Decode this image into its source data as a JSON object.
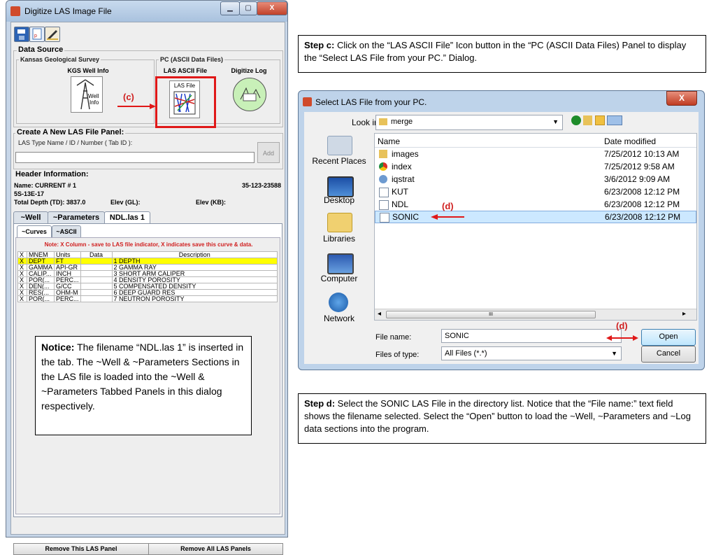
{
  "left_window": {
    "title": "Digitize LAS Image File",
    "window_buttons": [
      "▁",
      "▢",
      "X"
    ],
    "data_source": {
      "label": "Data Source",
      "kgs_group": "Kansas Geological Survey",
      "kgs_title": "KGS Well Info",
      "kgs_icon_text": "Well\nInfo",
      "pc_group": "PC (ASCII Data Files)",
      "las_title": "LAS ASCII File",
      "las_icon_text": "LAS File",
      "digitize_title": "Digitize Log",
      "callout": "(c)"
    },
    "create_panel": {
      "label": "Create A New LAS File Panel:",
      "sublabel": "LAS Type Name / ID / Number ( Tab ID ):",
      "input_value": "",
      "add_label": "Add"
    },
    "header_info": {
      "label": "Header Information:",
      "name": "Name: CURRENT # 1",
      "api": "35-123-23588",
      "location": "5S-13E-17",
      "total_depth": "Total Depth (TD): 3837.0",
      "elev_gl": "Elev (GL):",
      "elev_kb": "Elev (KB):"
    },
    "tabs": [
      "~Well",
      "~Parameters",
      "NDL.las 1"
    ],
    "subtabs": [
      "~Curves",
      "~ASCII"
    ],
    "note_text": "Note: X Column - save to LAS file indicator, X indicates save this curve & data.",
    "table": {
      "headers": [
        "X",
        "MNEM",
        "Units",
        "Data",
        "Description"
      ],
      "rows": [
        [
          "X",
          "DEPT",
          "FT",
          "",
          "1 DEPTH"
        ],
        [
          "X",
          "GAMMA",
          "API-GR",
          "",
          "2 GAMMA RAY"
        ],
        [
          "X",
          "CALIP...",
          "INCH",
          "",
          "3 SHORT ARM CALIPER"
        ],
        [
          "X",
          "POR(...",
          "PERC...",
          "",
          "4 DENSITY POROSITY"
        ],
        [
          "X",
          "DEN(...",
          "G/CC",
          "",
          "5 COMPENSATED DENSITY"
        ],
        [
          "X",
          "RES(...",
          "OHM-M",
          "",
          "6 DEEP GUARD RES"
        ],
        [
          "X",
          "POR(...",
          "PERC...",
          "",
          "7 NEUTRON POROSITY"
        ]
      ]
    },
    "bottom_buttons": [
      "Remove This LAS Panel",
      "Remove All LAS Panels"
    ]
  },
  "notice": {
    "bold": "Notice:",
    "text": " The filename “NDL.las 1” is inserted in the tab.  The ~Well & ~Parameters Sections in the LAS file is loaded into the ~Well & ~Parameters Tabbed Panels in this dialog respectively."
  },
  "step_c": {
    "bold": "Step c:",
    "text": " Click on the “LAS ASCII File” Icon button in the “PC (ASCII Data Files) Panel to display the “Select LAS File from your PC.” Dialog."
  },
  "step_d": {
    "bold": "Step d:",
    "text": " Select the SONIC LAS File in the directory list.  Notice that the “File name:” text field shows the filename selected.  Select the “Open” button to load the ~Well, ~Parameters and ~Log data sections into the program."
  },
  "file_dialog": {
    "title": "Select LAS File from your PC.",
    "close": "X",
    "look_in_label": "Look in:",
    "look_in_value": "merge",
    "places": [
      "Recent Places",
      "Desktop",
      "Libraries",
      "Computer",
      "Network"
    ],
    "columns": [
      "Name",
      "Date modified"
    ],
    "files": [
      {
        "name": "images",
        "date": "7/25/2012 10:13 AM",
        "icon": "folder-icon"
      },
      {
        "name": "index",
        "date": "7/25/2012 9:58 AM",
        "icon": "chrome-icon"
      },
      {
        "name": "iqstrat",
        "date": "3/6/2012 9:09 AM",
        "icon": "java-icon"
      },
      {
        "name": "KUT",
        "date": "6/23/2008 12:12 PM",
        "icon": "file-icon"
      },
      {
        "name": "NDL",
        "date": "6/23/2008 12:12 PM",
        "icon": "file-icon"
      },
      {
        "name": "SONIC",
        "date": "6/23/2008 12:12 PM",
        "icon": "file-icon"
      }
    ],
    "callout_list": "(d)",
    "callout_open": "(d)",
    "scroll_mid": "III",
    "file_name_label": "File name:",
    "file_name_value": "SONIC",
    "files_type_label": "Files of type:",
    "files_type_value": "All Files (*.*)",
    "open_label": "Open",
    "cancel_label": "Cancel"
  },
  "colors": {
    "callout": "#e01818",
    "selected_row": "#ffff00",
    "selection": "#cce8ff"
  }
}
